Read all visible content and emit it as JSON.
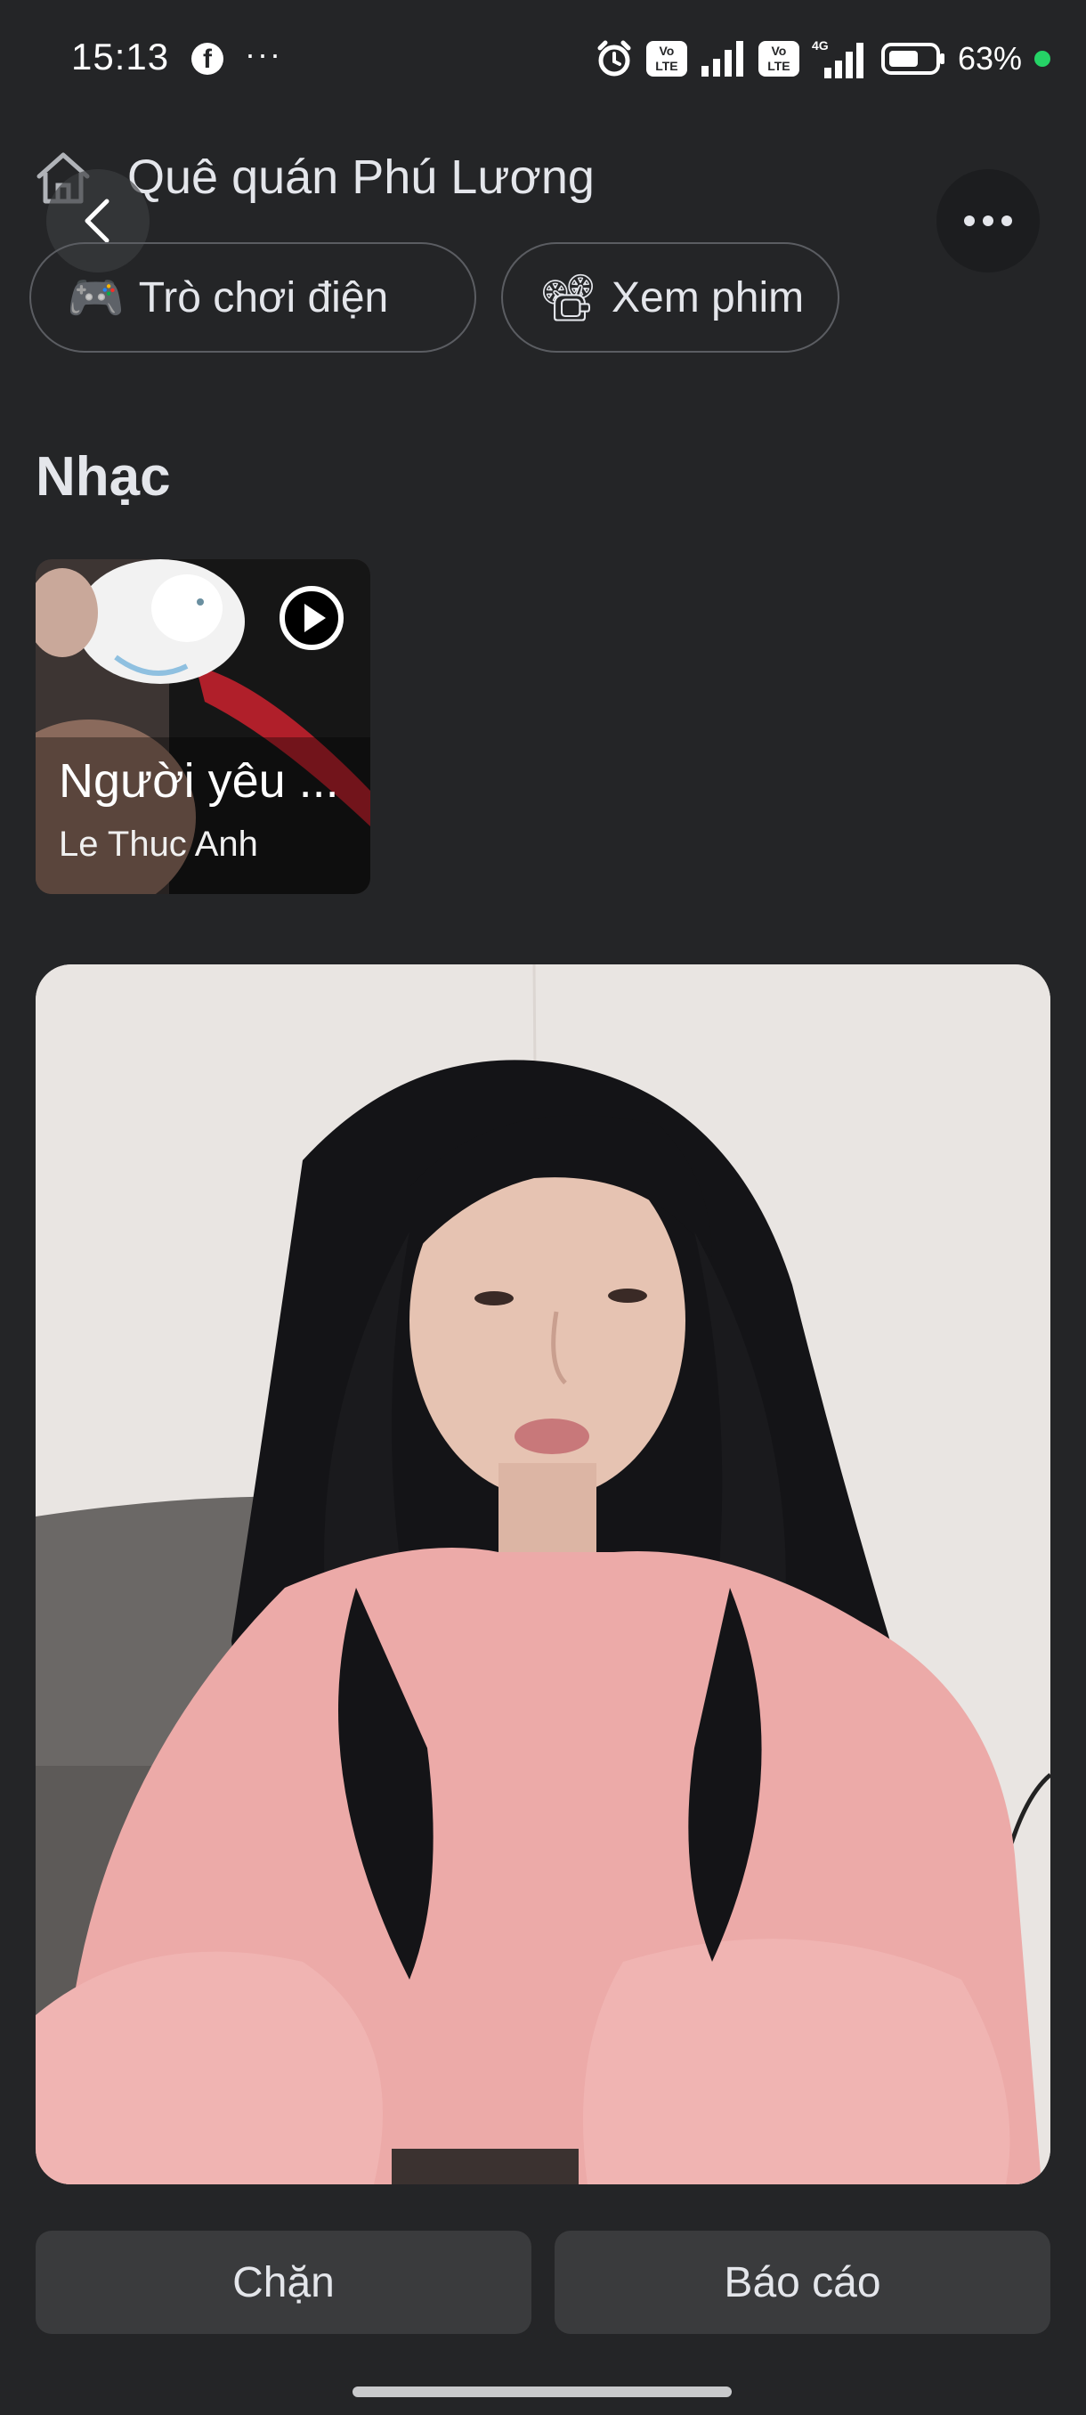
{
  "status_bar": {
    "time": "15:13",
    "fb_icon_letter": "f",
    "more": "···",
    "volte_1": "Vo LTE",
    "volte_2": "Vo LTE",
    "network_label": "4G",
    "battery": "63%",
    "icons": [
      "facebook-icon",
      "alarm-icon",
      "volte-icon",
      "signal-icon",
      "battery-icon"
    ]
  },
  "header": {
    "hometown_text": "Quê quán Phú Lương",
    "icons": [
      "home-icon",
      "back-icon",
      "more-icon"
    ]
  },
  "interests": [
    {
      "emoji": "🎮",
      "label": "Trò chơi điện"
    },
    {
      "emoji": "📽",
      "label": "Xem phim"
    }
  ],
  "music": {
    "section_title": "Nhạc",
    "song_title": "Người yêu ...",
    "artist": "Le Thuc Anh"
  },
  "actions": {
    "block_label": "Chặn",
    "report_label": "Báo cáo"
  },
  "colors": {
    "background": "#242527",
    "text": "#e4e6eb",
    "button_bg": "#3a3b3d",
    "online_dot": "#25d366"
  }
}
